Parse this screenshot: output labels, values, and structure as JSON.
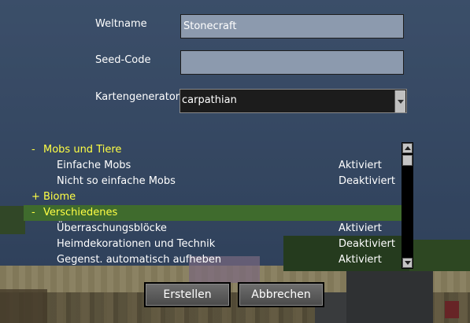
{
  "form": {
    "world_name_label": "Weltname",
    "world_name_value": "Stonecraft",
    "seed_label": "Seed-Code",
    "seed_value": "",
    "mapgen_label": "Kartengenerator",
    "mapgen_value": "carpathian"
  },
  "settings": {
    "rows": [
      {
        "kind": "category",
        "toggle": "-",
        "label": "Mobs und Tiere"
      },
      {
        "kind": "setting",
        "label": "Einfache Mobs",
        "status": "Aktiviert"
      },
      {
        "kind": "setting",
        "label": "Nicht so einfache Mobs",
        "status": "Deaktiviert"
      },
      {
        "kind": "category",
        "toggle": "+",
        "label": "Biome"
      },
      {
        "kind": "category",
        "toggle": "-",
        "label": "Verschiedenes",
        "selected": true
      },
      {
        "kind": "setting",
        "label": "Überraschungsblöcke",
        "status": "Aktiviert"
      },
      {
        "kind": "setting",
        "label": "Heimdekorationen und Technik",
        "status": "Deaktiviert"
      },
      {
        "kind": "setting",
        "label": "Gegenst. automatisch aufheben",
        "status": "Aktiviert"
      }
    ]
  },
  "buttons": {
    "create": "Erstellen",
    "cancel": "Abbrechen"
  },
  "colors": {
    "category_text": "#ffff44",
    "selected_row": "#3f6b2d",
    "field_bg": "#8c9aae"
  }
}
